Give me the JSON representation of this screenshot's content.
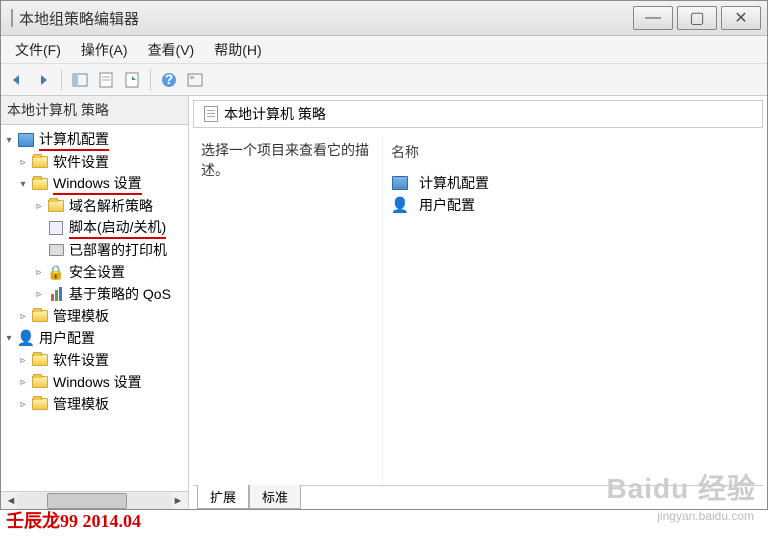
{
  "window": {
    "title": "本地组策略编辑器"
  },
  "menubar": {
    "file": "文件(F)",
    "action": "操作(A)",
    "view": "查看(V)",
    "help": "帮助(H)"
  },
  "tree": {
    "root": "本地计算机 策略",
    "items": [
      {
        "label": "计算机配置",
        "indent": 0,
        "arrow": "down",
        "icon": "comp",
        "underline": true
      },
      {
        "label": "软件设置",
        "indent": 1,
        "arrow": "right",
        "icon": "folder"
      },
      {
        "label": "Windows 设置",
        "indent": 1,
        "arrow": "down",
        "icon": "folder",
        "underline": true
      },
      {
        "label": "域名解析策略",
        "indent": 2,
        "arrow": "right",
        "icon": "folder"
      },
      {
        "label": "脚本(启动/关机)",
        "indent": 2,
        "arrow": "none",
        "icon": "script",
        "underline": true
      },
      {
        "label": "已部署的打印机",
        "indent": 2,
        "arrow": "none",
        "icon": "printer"
      },
      {
        "label": "安全设置",
        "indent": 2,
        "arrow": "right",
        "icon": "security"
      },
      {
        "label": "基于策略的 QoS",
        "indent": 2,
        "arrow": "right",
        "icon": "chart"
      },
      {
        "label": "管理模板",
        "indent": 1,
        "arrow": "right",
        "icon": "folder"
      },
      {
        "label": "用户配置",
        "indent": 0,
        "arrow": "down",
        "icon": "user"
      },
      {
        "label": "软件设置",
        "indent": 1,
        "arrow": "right",
        "icon": "folder"
      },
      {
        "label": "Windows 设置",
        "indent": 1,
        "arrow": "right",
        "icon": "folder"
      },
      {
        "label": "管理模板",
        "indent": 1,
        "arrow": "right",
        "icon": "folder"
      }
    ]
  },
  "right": {
    "header": "本地计算机 策略",
    "description": "选择一个项目来查看它的描述。",
    "column_header": "名称",
    "items": [
      {
        "label": "计算机配置",
        "icon": "comp"
      },
      {
        "label": "用户配置",
        "icon": "user"
      }
    ],
    "tabs": {
      "extended": "扩展",
      "standard": "标准"
    }
  },
  "watermark": {
    "red": "壬辰龙99 2014.04",
    "brand": "Baidu 经验",
    "url": "jingyan.baidu.com"
  }
}
